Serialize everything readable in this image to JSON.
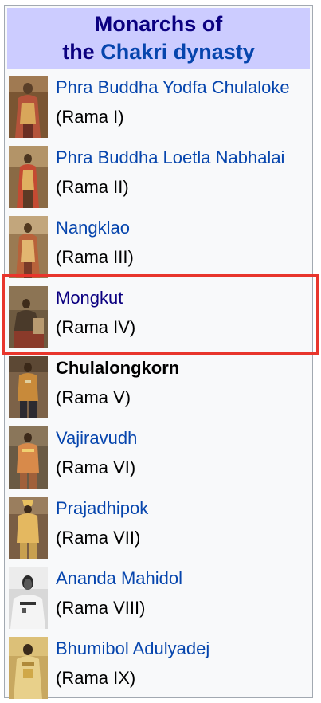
{
  "header": {
    "line1": "Monarchs of",
    "line2_prefix": "the",
    "line2_link": "Chakri dynasty"
  },
  "monarchs": [
    {
      "name": "Phra Buddha Yodfa Chulaloke",
      "regnal": "(Rama I)"
    },
    {
      "name": "Phra Buddha Loetla Nabhalai",
      "regnal": "(Rama II)"
    },
    {
      "name": "Nangklao",
      "regnal": "(Rama III)"
    },
    {
      "name": "Mongkut",
      "regnal": "(Rama IV)"
    },
    {
      "name": "Chulalongkorn",
      "regnal": "(Rama V)"
    },
    {
      "name": "Vajiravudh",
      "regnal": "(Rama VI)"
    },
    {
      "name": "Prajadhipok",
      "regnal": "(Rama VII)"
    },
    {
      "name": "Ananda Mahidol",
      "regnal": "(Rama VIII)"
    },
    {
      "name": "Bhumibol Adulyadej",
      "regnal": "(Rama IX)"
    }
  ],
  "colors": {
    "header_bg": "#ccccff",
    "link": "#0645ad",
    "visited_link": "#0b0080",
    "highlight": "#e8352c"
  }
}
